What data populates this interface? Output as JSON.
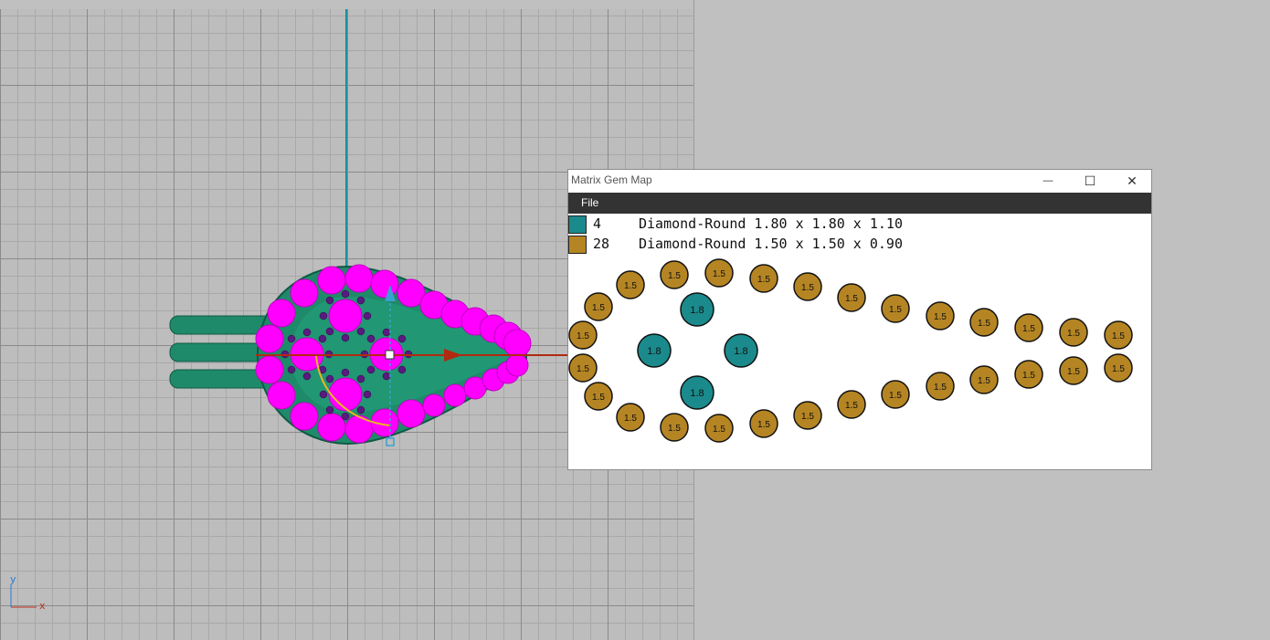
{
  "window": {
    "title": "Matrix Gem Map",
    "controls": {
      "minimize": "—",
      "maximize": "☐",
      "close": "✕"
    },
    "menu": {
      "file": "File"
    }
  },
  "legend": [
    {
      "color": "#1a8a8c",
      "count": "4",
      "description": "Diamond-Round 1.80 x 1.80 x 1.10"
    },
    {
      "color": "#b58523",
      "count": "28",
      "description": "Diamond-Round 1.50 x 1.50 x 0.90"
    }
  ],
  "gem_map": {
    "teal_color": "#1a8a8c",
    "gold_color": "#b58523",
    "teal_label": "1.8",
    "gold_label": "1.5",
    "teal_gem_count": 4,
    "gold_gem_count": 28
  },
  "viewport": {
    "axis_y": "y",
    "axis_x": "x",
    "grid_color": "#8a8a8a",
    "model_color": "#1f8a6a",
    "gem_color": "#ff00ff"
  }
}
